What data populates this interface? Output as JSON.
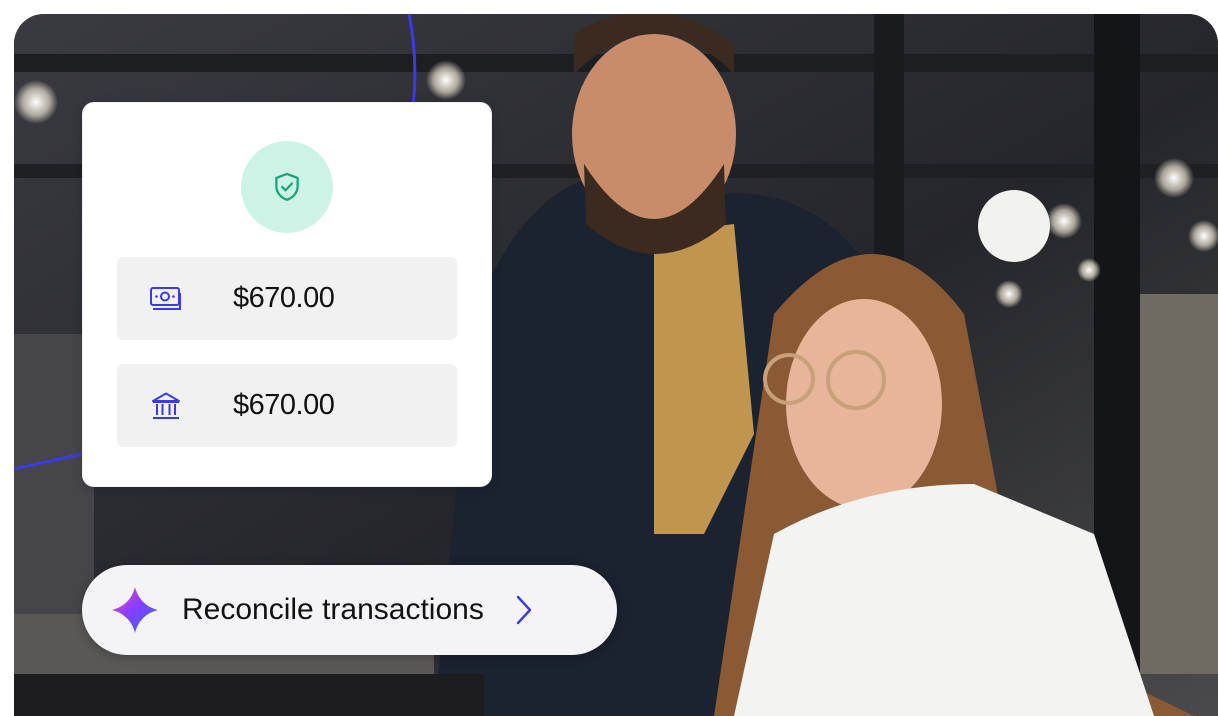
{
  "card": {
    "badge_icon": "shield-check-icon",
    "rows": [
      {
        "icon": "cash-icon",
        "amount": "$670.00"
      },
      {
        "icon": "bank-icon",
        "amount": "$670.00"
      }
    ]
  },
  "action": {
    "icon": "ai-sparkle-icon",
    "label": "Reconcile transactions",
    "chevron": "chevron-right-icon"
  },
  "colors": {
    "accent": "#3b3be6",
    "badge_bg": "#cdf3e7",
    "badge_icon": "#1aa37a"
  }
}
